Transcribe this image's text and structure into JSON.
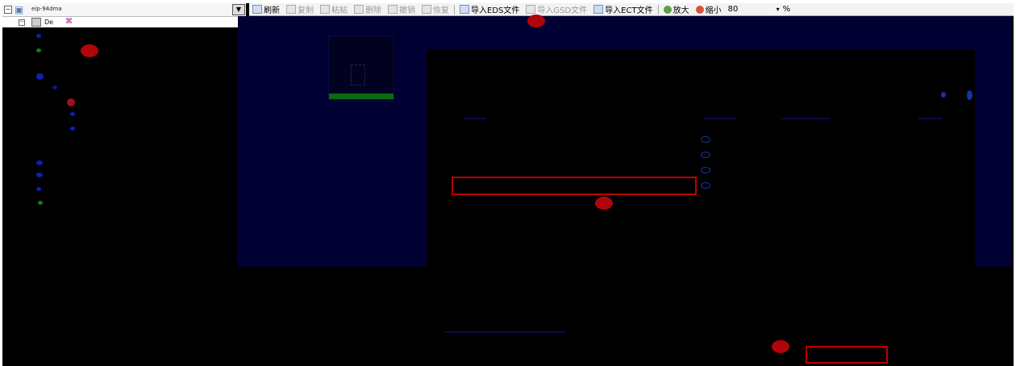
{
  "tree": {
    "root_label": "eip-94dma",
    "child_label": "De",
    "dropdown_arrow": "▼",
    "expand_glyph": "−"
  },
  "toolbar": {
    "items": [
      {
        "label": "刷新",
        "icon": "refresh-icon",
        "enabled": true
      },
      {
        "label": "复制",
        "icon": "copy-icon",
        "enabled": false
      },
      {
        "label": "粘贴",
        "icon": "paste-icon",
        "enabled": false
      },
      {
        "label": "删除",
        "icon": "delete-icon",
        "enabled": false
      },
      {
        "label": "撤销",
        "icon": "undo-icon",
        "enabled": false
      },
      {
        "label": "恢复",
        "icon": "redo-icon",
        "enabled": false
      },
      {
        "label": "导入EDS文件",
        "icon": "import-eds-icon",
        "enabled": true
      },
      {
        "label": "导入GSD文件",
        "icon": "import-gsd-icon",
        "enabled": false
      },
      {
        "label": "导入ECT文件",
        "icon": "import-ect-icon",
        "enabled": true
      },
      {
        "label": "放大",
        "icon": "zoom-in-icon",
        "enabled": true
      },
      {
        "label": "缩小",
        "icon": "zoom-out-icon",
        "enabled": true
      }
    ],
    "zoom_value": "80",
    "zoom_unit": "%"
  },
  "colors": {
    "workspace_bg": "#000033",
    "annotation_red": "#c00000",
    "device_green": "#0a6b12"
  }
}
